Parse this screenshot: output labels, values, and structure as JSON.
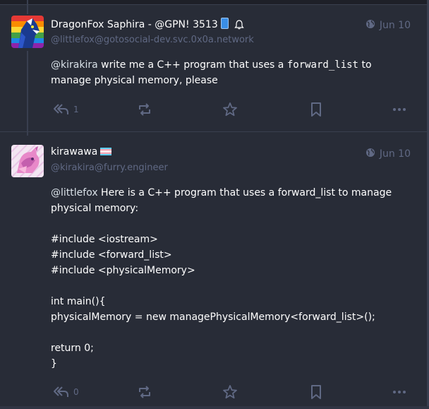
{
  "posts": [
    {
      "display_name": "DragonFox Saphira - @GPN! 3513",
      "acct": "@littlefox@gotosocial-dev.svc.0x0a.network",
      "date": "Jun 10",
      "content": {
        "mention": "@kirakira",
        "text_before_code": " write me a C++ program that uses a ",
        "code": "forward_list",
        "text_after_code": " to manage physical memory, please"
      },
      "reply_count": "1",
      "visibility_icon": "globe-icon"
    },
    {
      "display_name": "kirawawa",
      "acct": "@kirakira@furry.engineer",
      "date": "Jun 10",
      "content": {
        "mention": "@littlefox",
        "intro": " Here is a C++ program that uses a forward_list to manage physical memory:",
        "code_lines": [
          "#include <iostream>",
          "#include <forward_list>",
          "#include <physicalMemory>",
          "",
          "int main(){",
          "physicalMemory = new managePhysicalMemory<forward_list>();",
          "",
          "return 0;",
          "}"
        ]
      },
      "reply_count": "0",
      "visibility_icon": "globe-icon"
    }
  ],
  "colors": {
    "background": "#282c37",
    "muted": "#606984",
    "text": "#ffffff"
  }
}
